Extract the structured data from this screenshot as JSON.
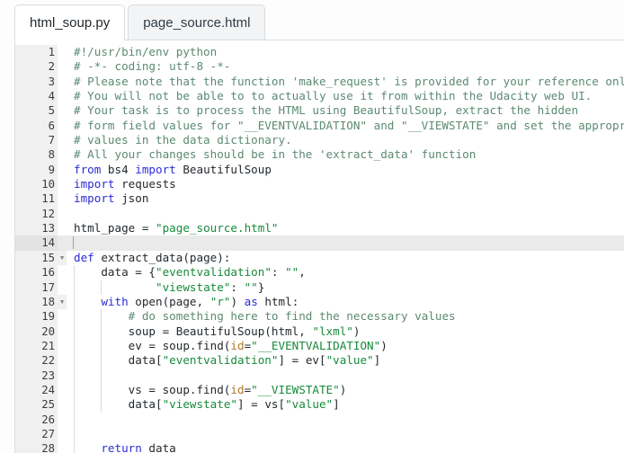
{
  "window": {
    "title": "html_soup.py"
  },
  "tabs": [
    {
      "label": "html_soup.py",
      "active": true
    },
    {
      "label": "page_source.html",
      "active": false
    }
  ],
  "editor": {
    "language": "python",
    "current_line": 14,
    "first_visible_line": 1,
    "last_visible_line": 28,
    "colors": {
      "background": "#ffffff",
      "gutter_background": "#f0f0f0",
      "current_line_highlight": "#eaeaea",
      "comment": "#5b8a72",
      "keyword": "#2b2bd8",
      "string": "#178a3a",
      "text": "#23292e",
      "keyword_argument": "#b07a2e",
      "indent_guide": "#dcdcdc",
      "tab_border": "#d9dde1",
      "inactive_tab_background": "#f3f4f6"
    },
    "lines": [
      {
        "n": 1,
        "fold": "",
        "indent": 0,
        "tokens": [
          {
            "t": "cm",
            "v": "#!/usr/bin/env python"
          }
        ]
      },
      {
        "n": 2,
        "fold": "",
        "indent": 0,
        "tokens": [
          {
            "t": "cm",
            "v": "# -*- coding: utf-8 -*-"
          }
        ]
      },
      {
        "n": 3,
        "fold": "",
        "indent": 0,
        "tokens": [
          {
            "t": "cm",
            "v": "# Please note that the function 'make_request' is provided for your reference only."
          }
        ]
      },
      {
        "n": 4,
        "fold": "",
        "indent": 0,
        "tokens": [
          {
            "t": "cm",
            "v": "# You will not be able to to actually use it from within the Udacity web UI."
          }
        ]
      },
      {
        "n": 5,
        "fold": "",
        "indent": 0,
        "tokens": [
          {
            "t": "cm",
            "v": "# Your task is to process the HTML using BeautifulSoup, extract the hidden"
          }
        ]
      },
      {
        "n": 6,
        "fold": "",
        "indent": 0,
        "tokens": [
          {
            "t": "cm",
            "v": "# form field values for \"__EVENTVALIDATION\" and \"__VIEWSTATE\" and set the appropriate"
          }
        ]
      },
      {
        "n": 7,
        "fold": "",
        "indent": 0,
        "tokens": [
          {
            "t": "cm",
            "v": "# values in the data dictionary."
          }
        ]
      },
      {
        "n": 8,
        "fold": "",
        "indent": 0,
        "tokens": [
          {
            "t": "cm",
            "v": "# All your changes should be in the 'extract_data' function"
          }
        ]
      },
      {
        "n": 9,
        "fold": "",
        "indent": 0,
        "tokens": [
          {
            "t": "kw",
            "v": "from"
          },
          {
            "t": "nm",
            "v": " bs4 "
          },
          {
            "t": "kw",
            "v": "import"
          },
          {
            "t": "nm",
            "v": " BeautifulSoup"
          }
        ]
      },
      {
        "n": 10,
        "fold": "",
        "indent": 0,
        "tokens": [
          {
            "t": "kw",
            "v": "import"
          },
          {
            "t": "nm",
            "v": " requests"
          }
        ]
      },
      {
        "n": 11,
        "fold": "",
        "indent": 0,
        "tokens": [
          {
            "t": "kw",
            "v": "import"
          },
          {
            "t": "nm",
            "v": " json"
          }
        ]
      },
      {
        "n": 12,
        "fold": "",
        "indent": 0,
        "tokens": []
      },
      {
        "n": 13,
        "fold": "",
        "indent": 0,
        "tokens": [
          {
            "t": "nm",
            "v": "html_page = "
          },
          {
            "t": "st",
            "v": "\"page_source.html\""
          }
        ]
      },
      {
        "n": 14,
        "fold": "",
        "indent": 0,
        "tokens": []
      },
      {
        "n": 15,
        "fold": "▾",
        "indent": 0,
        "tokens": [
          {
            "t": "kw",
            "v": "def"
          },
          {
            "t": "nm",
            "v": " extract_data(page):"
          }
        ]
      },
      {
        "n": 16,
        "fold": "",
        "indent": 1,
        "tokens": [
          {
            "t": "nm",
            "v": "    data = {"
          },
          {
            "t": "st",
            "v": "\"eventvalidation\""
          },
          {
            "t": "nm",
            "v": ": "
          },
          {
            "t": "st",
            "v": "\"\""
          },
          {
            "t": "nm",
            "v": ","
          }
        ]
      },
      {
        "n": 17,
        "fold": "",
        "indent": 2,
        "tokens": [
          {
            "t": "nm",
            "v": "            "
          },
          {
            "t": "st",
            "v": "\"viewstate\""
          },
          {
            "t": "nm",
            "v": ": "
          },
          {
            "t": "st",
            "v": "\"\""
          },
          {
            "t": "nm",
            "v": "}"
          }
        ]
      },
      {
        "n": 18,
        "fold": "▾",
        "indent": 1,
        "tokens": [
          {
            "t": "nm",
            "v": "    "
          },
          {
            "t": "kw",
            "v": "with"
          },
          {
            "t": "nm",
            "v": " open(page, "
          },
          {
            "t": "st",
            "v": "\"r\""
          },
          {
            "t": "nm",
            "v": ") "
          },
          {
            "t": "kw",
            "v": "as"
          },
          {
            "t": "nm",
            "v": " html:"
          }
        ]
      },
      {
        "n": 19,
        "fold": "",
        "indent": 2,
        "tokens": [
          {
            "t": "nm",
            "v": "        "
          },
          {
            "t": "cm",
            "v": "# do something here to find the necessary values"
          }
        ]
      },
      {
        "n": 20,
        "fold": "",
        "indent": 2,
        "tokens": [
          {
            "t": "nm",
            "v": "        soup = BeautifulSoup(html, "
          },
          {
            "t": "st",
            "v": "\"lxml\""
          },
          {
            "t": "nm",
            "v": ")"
          }
        ]
      },
      {
        "n": 21,
        "fold": "",
        "indent": 2,
        "tokens": [
          {
            "t": "nm",
            "v": "        ev = soup.find("
          },
          {
            "t": "kwa",
            "v": "id"
          },
          {
            "t": "nm",
            "v": "="
          },
          {
            "t": "st",
            "v": "\"__EVENTVALIDATION\""
          },
          {
            "t": "nm",
            "v": ")"
          }
        ]
      },
      {
        "n": 22,
        "fold": "",
        "indent": 2,
        "tokens": [
          {
            "t": "nm",
            "v": "        data["
          },
          {
            "t": "st",
            "v": "\"eventvalidation\""
          },
          {
            "t": "nm",
            "v": "] = ev["
          },
          {
            "t": "st",
            "v": "\"value\""
          },
          {
            "t": "nm",
            "v": "]"
          }
        ]
      },
      {
        "n": 23,
        "fold": "",
        "indent": 2,
        "tokens": []
      },
      {
        "n": 24,
        "fold": "",
        "indent": 2,
        "tokens": [
          {
            "t": "nm",
            "v": "        vs = soup.find("
          },
          {
            "t": "kwa",
            "v": "id"
          },
          {
            "t": "nm",
            "v": "="
          },
          {
            "t": "st",
            "v": "\"__VIEWSTATE\""
          },
          {
            "t": "nm",
            "v": ")"
          }
        ]
      },
      {
        "n": 25,
        "fold": "",
        "indent": 2,
        "tokens": [
          {
            "t": "nm",
            "v": "        data["
          },
          {
            "t": "st",
            "v": "\"viewstate\""
          },
          {
            "t": "nm",
            "v": "] = vs["
          },
          {
            "t": "st",
            "v": "\"value\""
          },
          {
            "t": "nm",
            "v": "]"
          }
        ]
      },
      {
        "n": 26,
        "fold": "",
        "indent": 1,
        "tokens": []
      },
      {
        "n": 27,
        "fold": "",
        "indent": 1,
        "tokens": []
      },
      {
        "n": 28,
        "fold": "",
        "indent": 1,
        "tokens": [
          {
            "t": "nm",
            "v": "    "
          },
          {
            "t": "kw",
            "v": "return"
          },
          {
            "t": "nm",
            "v": " data"
          }
        ]
      }
    ]
  }
}
